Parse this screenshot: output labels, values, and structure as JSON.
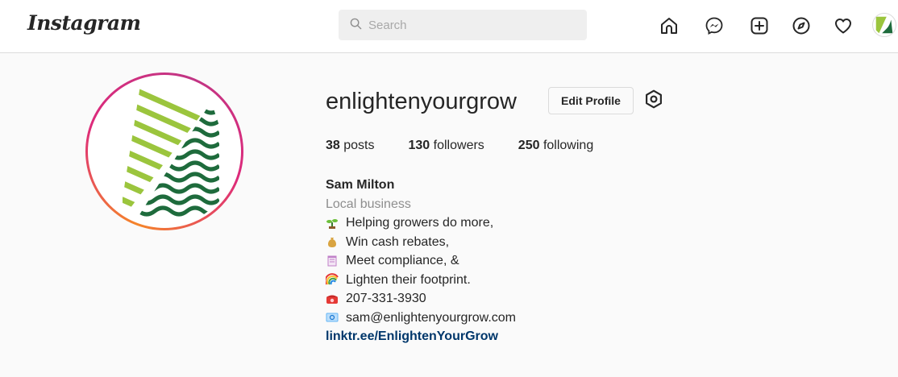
{
  "header": {
    "logo": "Instagram",
    "search_placeholder": "Search"
  },
  "nav": {
    "icons": [
      "home-icon",
      "messenger-icon",
      "new-post-icon",
      "explore-icon",
      "activity-heart-icon",
      "profile-avatar"
    ]
  },
  "profile": {
    "username": "enlightenyourgrow",
    "edit_button": "Edit Profile",
    "stats": {
      "posts_count": "38",
      "posts_label": "posts",
      "followers_count": "130",
      "followers_label": "followers",
      "following_count": "250",
      "following_label": "following"
    },
    "bio": {
      "name": "Sam Milton",
      "category": "Local business",
      "lines": [
        {
          "emoji": "seedling",
          "text": "Helping growers do more,"
        },
        {
          "emoji": "money-bag",
          "text": "Win cash rebates,"
        },
        {
          "emoji": "notepad",
          "text": "Meet compliance, &"
        },
        {
          "emoji": "rainbow",
          "text": "Lighten their footprint."
        },
        {
          "emoji": "telephone",
          "text": "207-331-3930"
        },
        {
          "emoji": "email",
          "text": "sam@enlightenyourgrow.com"
        }
      ],
      "link": "linktr.ee/EnlightenYourGrow"
    }
  },
  "colors": {
    "accent_green_light": "#9bc53d",
    "accent_green_dark": "#1e6b3c",
    "link_blue": "#00376b",
    "ring_orange": "#f58529",
    "ring_pink": "#dd2a7b"
  }
}
